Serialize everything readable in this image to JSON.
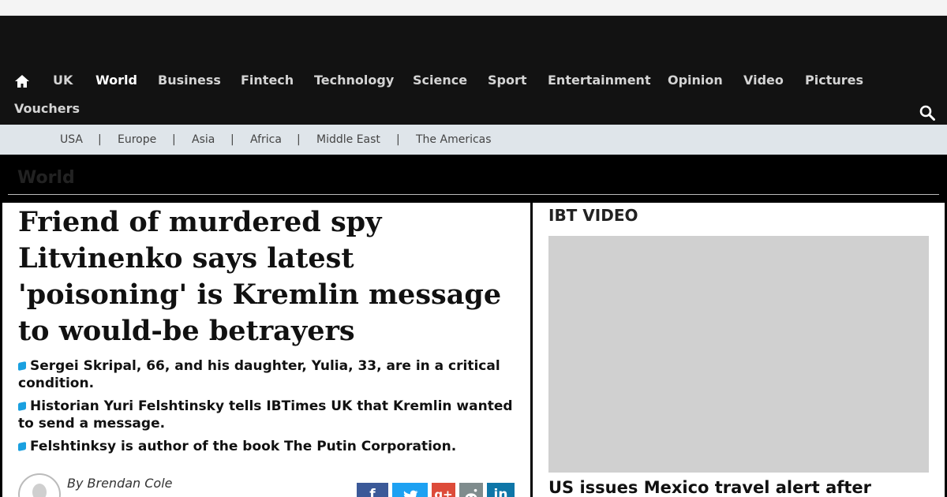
{
  "nav": {
    "items": [
      "UK",
      "World",
      "Business",
      "Fintech",
      "Technology",
      "Science",
      "Sport",
      "Entertainment",
      "Opinion",
      "Video",
      "Pictures",
      "Vouchers"
    ],
    "active": "World"
  },
  "subnav": {
    "items": [
      "USA",
      "Europe",
      "Asia",
      "Africa",
      "Middle East",
      "The Americas"
    ],
    "separator": "|"
  },
  "section": {
    "title": "World"
  },
  "article": {
    "headline": "Friend of murdered spy Litvinenko says latest 'poisoning' is Kremlin message to would-be betrayers",
    "bullets": [
      "Sergei Skripal, 66, and his daughter, Yulia, 33, are in a critical condition.",
      "Historian Yuri Felshtinsky tells IBTimes UK that Kremlin wanted to send a message.",
      "Felshtinksy is author of the book The Putin Corporation."
    ],
    "byline": "By Brendan Cole"
  },
  "share": {
    "facebook": "f",
    "google": "g+",
    "linkedin": "in",
    "colors": {
      "facebook": "#3b5998",
      "twitter": "#1da1f2",
      "google": "#dd4b39",
      "reddit": "#7f8c8d",
      "linkedin": "#0e76a8"
    }
  },
  "sidebar": {
    "title": "IBT VIDEO",
    "video_headline": "US issues Mexico travel alert after"
  },
  "colors": {
    "header_bg": "#121212",
    "subnav_bg": "#dfe5ea",
    "bullet_accent": "#1aa0e0"
  }
}
